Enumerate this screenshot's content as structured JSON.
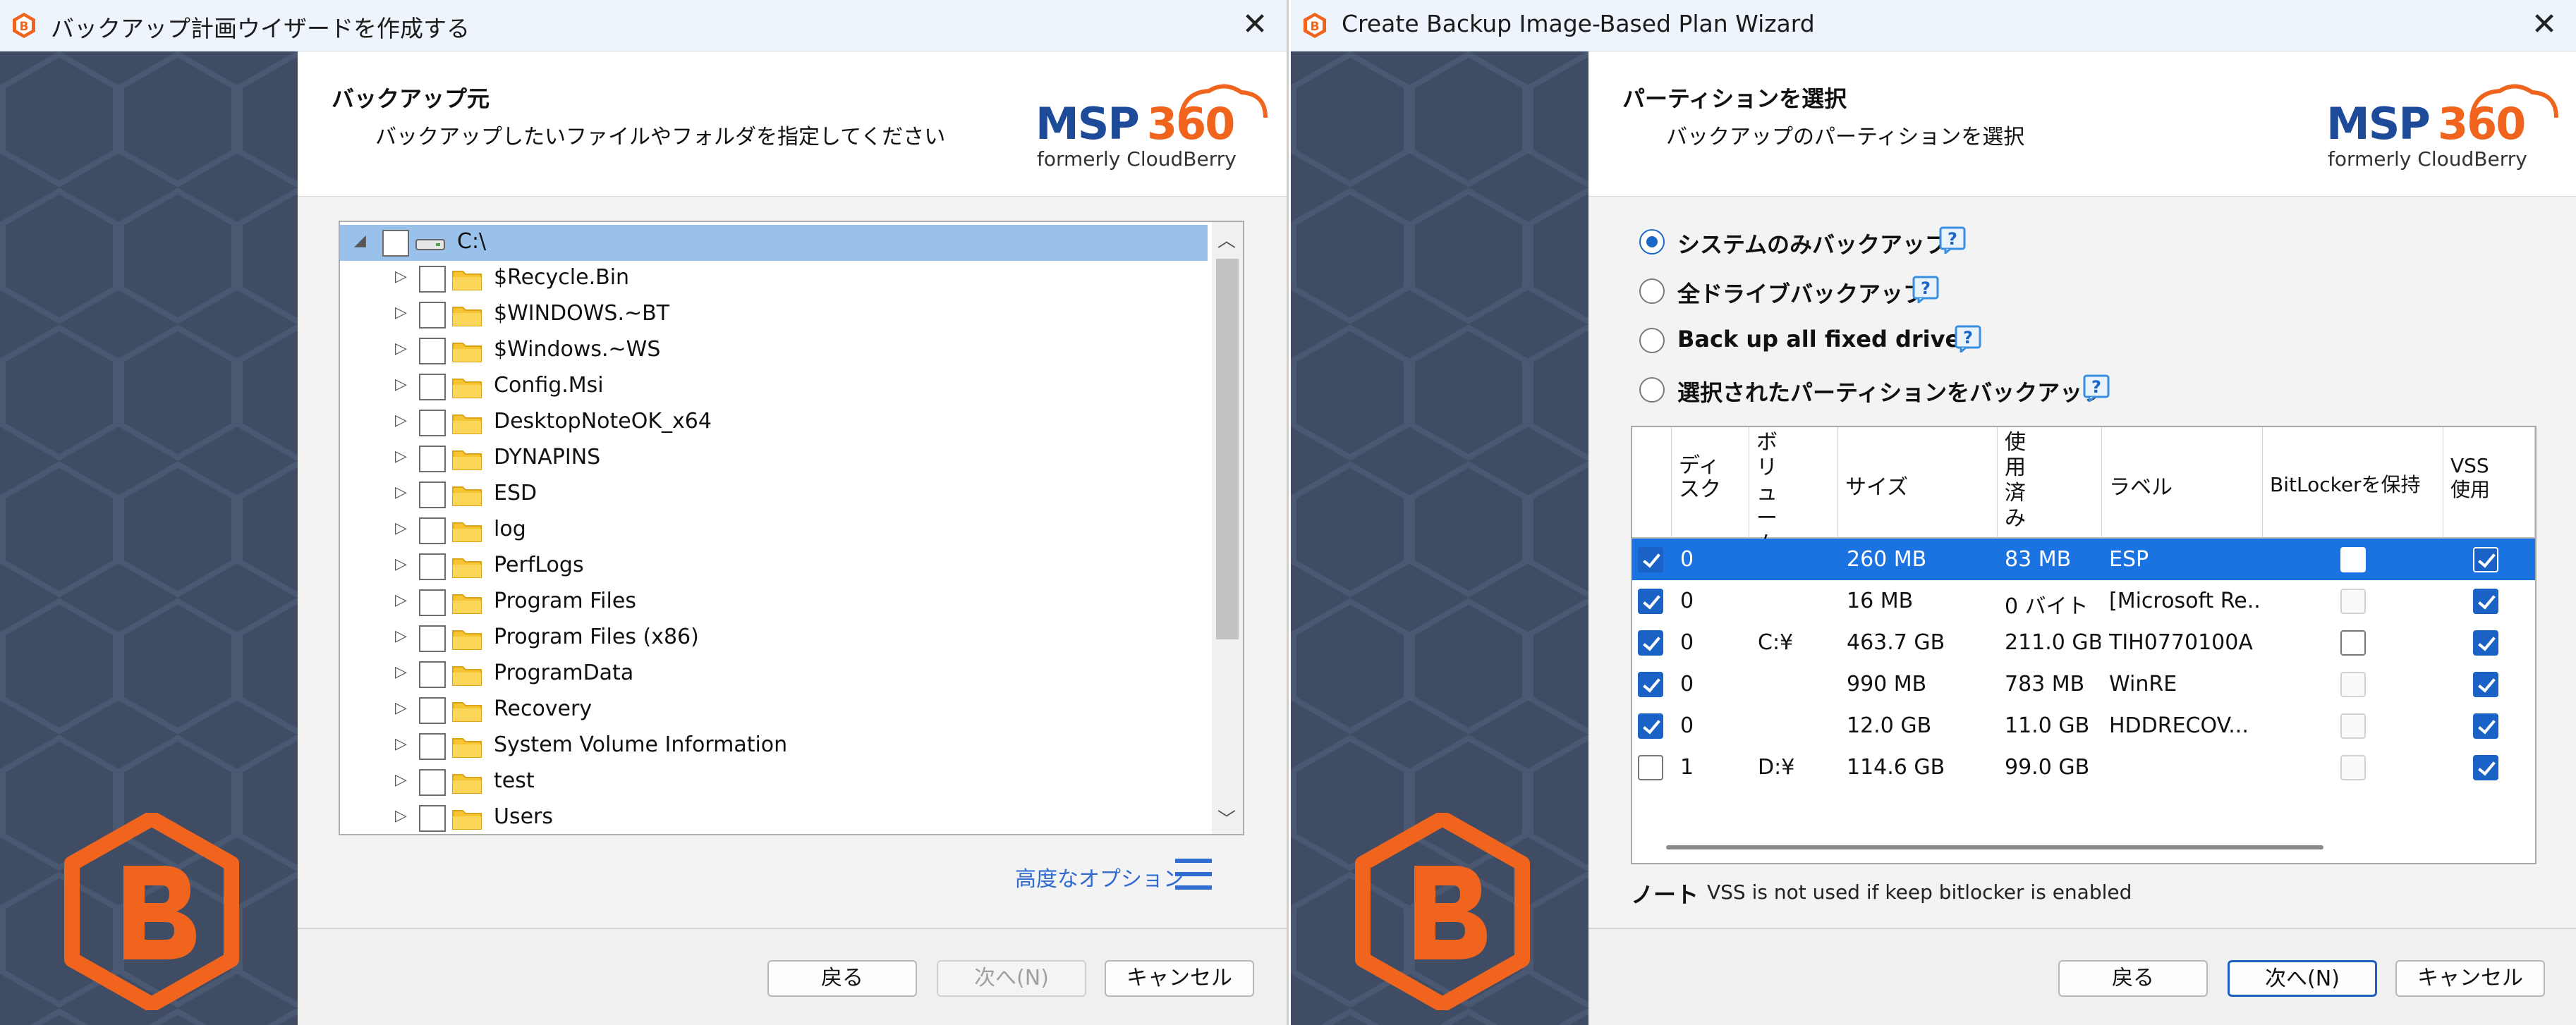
{
  "left_window": {
    "title": "バックアップ計画ウイザードを作成する",
    "header_title": "バックアップ元",
    "header_subtitle": "バックアップしたいファイルやフォルダを指定してください",
    "brand": {
      "logo": "MSP360",
      "tagline": "formerly CloudBerry"
    },
    "tree": {
      "root": "C:\\",
      "items": [
        "$Recycle.Bin",
        "$WINDOWS.~BT",
        "$Windows.~WS",
        "Config.Msi",
        "DesktopNoteOK_x64",
        "DYNAPINS",
        "ESD",
        "log",
        "PerfLogs",
        "Program Files",
        "Program Files (x86)",
        "ProgramData",
        "Recovery",
        "System Volume Information",
        "test",
        "Users"
      ]
    },
    "advanced_link": "高度なオプション",
    "buttons": {
      "back": "戻る",
      "next": "次へ(N)",
      "cancel": "キャンセル"
    }
  },
  "right_window": {
    "title": "Create Backup Image-Based Plan Wizard",
    "header_title": "パーティションを選択",
    "header_subtitle": "バックアップのパーティションを選択",
    "brand": {
      "logo": "MSP360",
      "tagline": "formerly CloudBerry"
    },
    "options": [
      {
        "label": "システムのみバックアップ",
        "selected": true
      },
      {
        "label": "全ドライブバックアップ",
        "selected": false
      },
      {
        "label": "Back up all fixed drives",
        "selected": false
      },
      {
        "label": "選択されたパーティションをバックアップ",
        "selected": false
      }
    ],
    "grid": {
      "headers": {
        "disk": "ディスク",
        "volume": "ボリューム",
        "size": "サイズ",
        "used": "使用済み",
        "label": "ラベル",
        "bitlocker": "BitLockerを保持",
        "vss": "VSS使用"
      },
      "rows": [
        {
          "checked": true,
          "disk": "0",
          "volume": "",
          "size": "260 MB",
          "used": "83 MB",
          "label": "ESP",
          "bitlocker": "empty",
          "vss": true,
          "selected": true
        },
        {
          "checked": true,
          "disk": "0",
          "volume": "",
          "size": "16 MB",
          "used": "0 バイト",
          "label": "[Microsoft Re...",
          "bitlocker": "disabled",
          "vss": true,
          "selected": false
        },
        {
          "checked": true,
          "disk": "0",
          "volume": "C:¥",
          "size": "463.7 GB",
          "used": "211.0 GB",
          "label": "TIH0770100A",
          "bitlocker": "unchecked",
          "vss": true,
          "selected": false
        },
        {
          "checked": true,
          "disk": "0",
          "volume": "",
          "size": "990 MB",
          "used": "783 MB",
          "label": "WinRE",
          "bitlocker": "disabled",
          "vss": true,
          "selected": false
        },
        {
          "checked": true,
          "disk": "0",
          "volume": "",
          "size": "12.0 GB",
          "used": "11.0 GB",
          "label": "HDDRECOV...",
          "bitlocker": "disabled",
          "vss": true,
          "selected": false
        },
        {
          "checked": false,
          "disk": "1",
          "volume": "D:¥",
          "size": "114.6 GB",
          "used": "99.0 GB",
          "label": "",
          "bitlocker": "disabled",
          "vss": true,
          "selected": false
        }
      ]
    },
    "note_label": "ノート",
    "note_text": "VSS is not used if keep bitlocker is enabled",
    "buttons": {
      "back": "戻る",
      "next": "次へ(N)",
      "cancel": "キャンセル"
    }
  },
  "colors": {
    "accent": "#1a73e0",
    "brand_orange": "#f0641e",
    "sidebar": "#3f4c63",
    "link": "#2f6bd1"
  }
}
